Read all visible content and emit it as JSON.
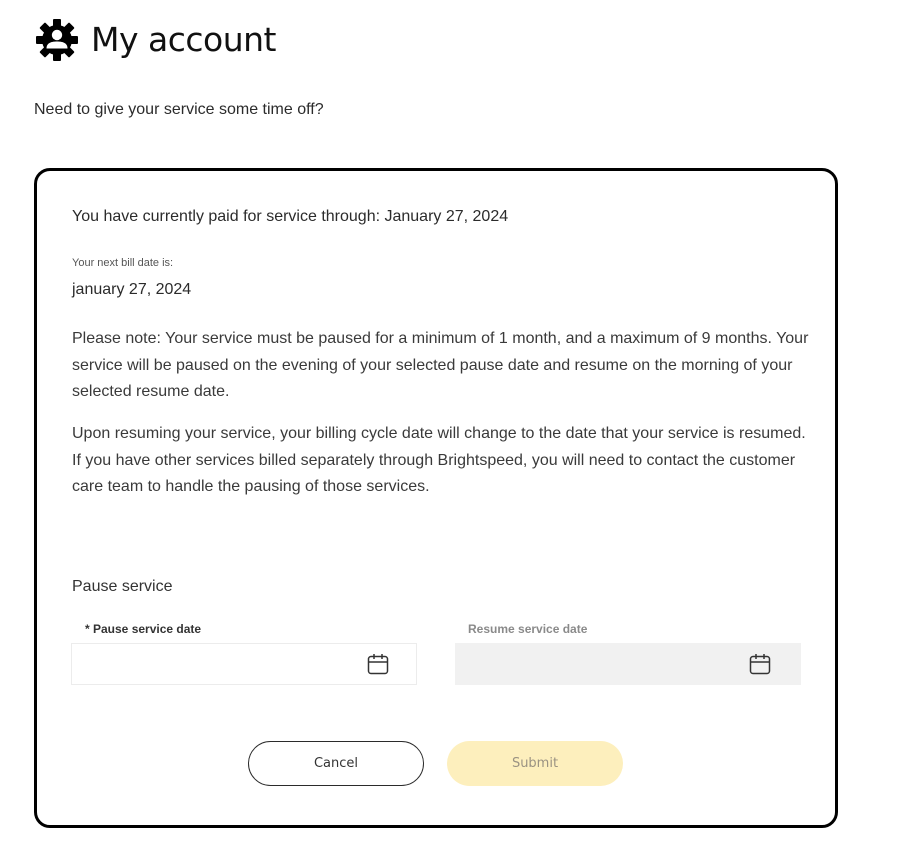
{
  "header": {
    "icon": "account-gear-icon",
    "title": "My account"
  },
  "subtitle": "Need to give your service some time off?",
  "card": {
    "paid_through_text": "You have currently paid for service through: January 27, 2024",
    "next_bill_label": "Your next bill date is:",
    "next_bill_value": "january 27, 2024",
    "note_1": "Please note: Your service must be paused for a minimum of 1 month, and a maximum of 9 months. Your service will be paused on the evening of your selected pause date and resume on the morning of your selected resume date.",
    "note_2": "Upon resuming your service, your billing cycle date will change to the date that your service is resumed. If you have other services billed separately through Brightspeed, you will need to contact the customer care team to handle the pausing of those services.",
    "section_title": "Pause service",
    "pause_field": {
      "label": "* Pause service date",
      "value": "",
      "placeholder": "",
      "icon": "calendar-icon",
      "required": true
    },
    "resume_field": {
      "label": "Resume service date",
      "value": "",
      "placeholder": "",
      "icon": "calendar-icon",
      "disabled": true
    },
    "buttons": {
      "cancel_label": "Cancel",
      "submit_label": "Submit",
      "submit_disabled": true
    }
  },
  "colors": {
    "card_border": "#000000",
    "submit_bg": "#fdefbd",
    "disabled_field_bg": "#f1f1f1"
  }
}
